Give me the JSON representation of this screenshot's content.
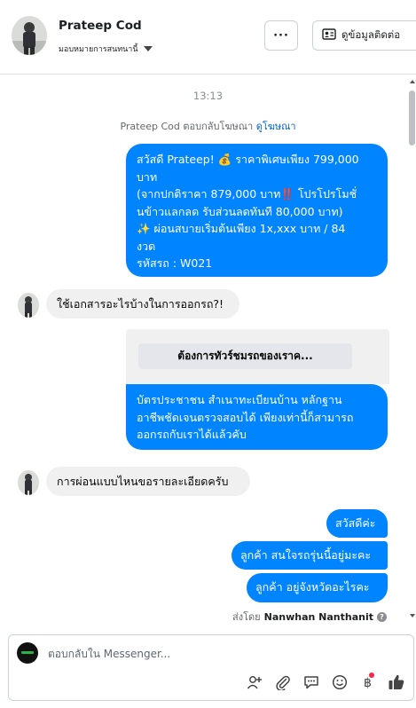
{
  "header": {
    "contact_name": "Prateep Cod",
    "assign_label": "มอบหมายการสนทนานี้",
    "more_label": "···",
    "details_label": "ดูข้อมูลติดต่อ"
  },
  "thread": {
    "timestamp": "13:13",
    "reply_note_prefix": "Prateep Cod ตอบกลับโฆษณา",
    "reply_note_link": "ดูโฆษณา",
    "ad_message_lines": [
      "สวัสดี Prateep! 💰 ราคาพิเศษเพียง 799,000",
      "บาท",
      "(จากปกติราคา 879,000 บาท‼️ โปรโปรโมชั่",
      "นข้าวแลกลด รับส่วนลดทันที 80,000 บาท)",
      "✨ ผ่อนสบายเริ่มต้นเพียง 1x,xxx บาท / 84",
      "งวด",
      " รหัสรถ : W021"
    ],
    "incoming_1": "ใช้เอกสารอะไรบ้างในการออกรถ?!",
    "template_button": "ต้องการทัวร์ชมรถของเราค...",
    "reply_docs_lines": [
      "บัตรประชาชน สำเนาทะเบียนบ้าน หลักฐาน",
      "อาชีพชัดเจนตรวจสอบได้ เพียงเท่านี้ก็สามารถ",
      "ออกรถกับเราได้แล้วคับ"
    ],
    "incoming_2": "การผ่อนแบบไหนขอรายละเอียดครับ",
    "outgoing_greeting": "สวัสดีค่ะ",
    "outgoing_q1": "ลูกค้า สนใจรถรุ่นนี้อยู่มะคะ",
    "outgoing_q2": "ลูกค้า อยู่จังหวัดอะไรคะ",
    "sent_by_prefix": "ส่งโดย",
    "sent_by_name": "Nanwhan Nanthanit",
    "info_glyph": "?"
  },
  "composer": {
    "placeholder": "ตอบกลับใน Messenger...",
    "icons": [
      "add-person-icon",
      "attachment-icon",
      "saved-reply-icon",
      "emoji-icon",
      "payment-icon",
      "like-icon"
    ]
  },
  "colors": {
    "outgoing_bubble": "#0084ff",
    "incoming_bubble": "#f0f0f0",
    "link": "#0064d1",
    "like": "#0866ff",
    "notification_dot": "#f02849"
  }
}
